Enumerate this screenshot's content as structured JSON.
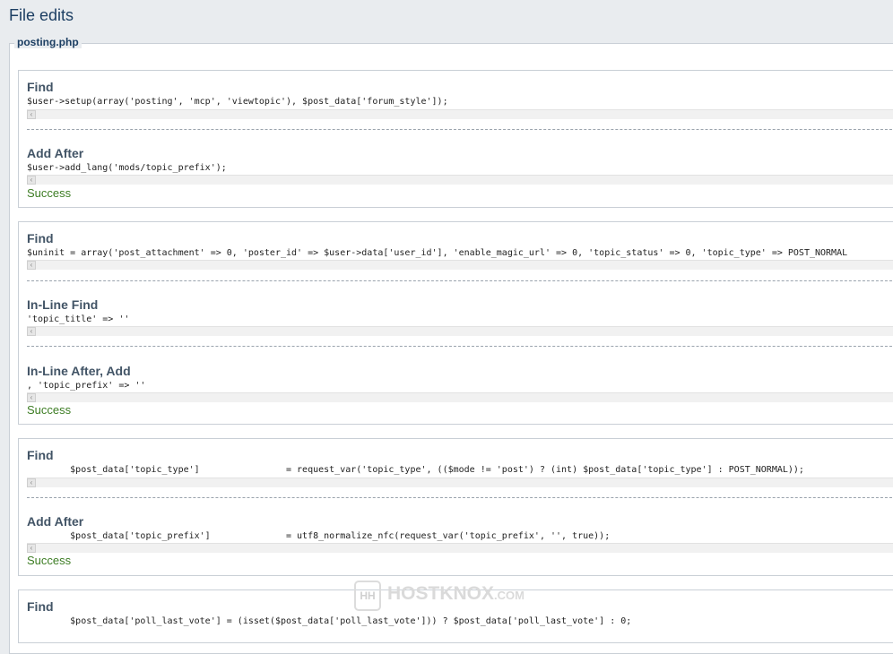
{
  "page_title": "File edits",
  "file_legend": "posting.php",
  "edits": [
    {
      "sections": [
        {
          "heading": "Find",
          "code": "$user->setup(array('posting', 'mcp', 'viewtopic'), $post_data['forum_style']);"
        },
        {
          "heading": "Add After",
          "code": "$user->add_lang('mods/topic_prefix');"
        }
      ],
      "status": "Success"
    },
    {
      "sections": [
        {
          "heading": "Find",
          "code": "$uninit = array('post_attachment' => 0, 'poster_id' => $user->data['user_id'], 'enable_magic_url' => 0, 'topic_status' => 0, 'topic_type' => POST_NORMAL"
        },
        {
          "heading": "In-Line Find",
          "code": "'topic_title' => ''"
        },
        {
          "heading": "In-Line After, Add",
          "code": ", 'topic_prefix' => ''"
        }
      ],
      "status": "Success"
    },
    {
      "sections": [
        {
          "heading": "Find",
          "code": "        $post_data['topic_type']                = request_var('topic_type', (($mode != 'post') ? (int) $post_data['topic_type'] : POST_NORMAL));"
        },
        {
          "heading": "Add After",
          "code": "        $post_data['topic_prefix']              = utf8_normalize_nfc(request_var('topic_prefix', '', true));"
        }
      ],
      "status": "Success"
    },
    {
      "sections": [
        {
          "heading": "Find",
          "code": "        $post_data['poll_last_vote'] = (isset($post_data['poll_last_vote'])) ? $post_data['poll_last_vote'] : 0;"
        }
      ],
      "status": ""
    }
  ],
  "scroll_arrow_glyph": "‹",
  "watermark": {
    "icon_text": "HH",
    "text": "HOSTKNOX",
    "suffix": ".COM"
  }
}
